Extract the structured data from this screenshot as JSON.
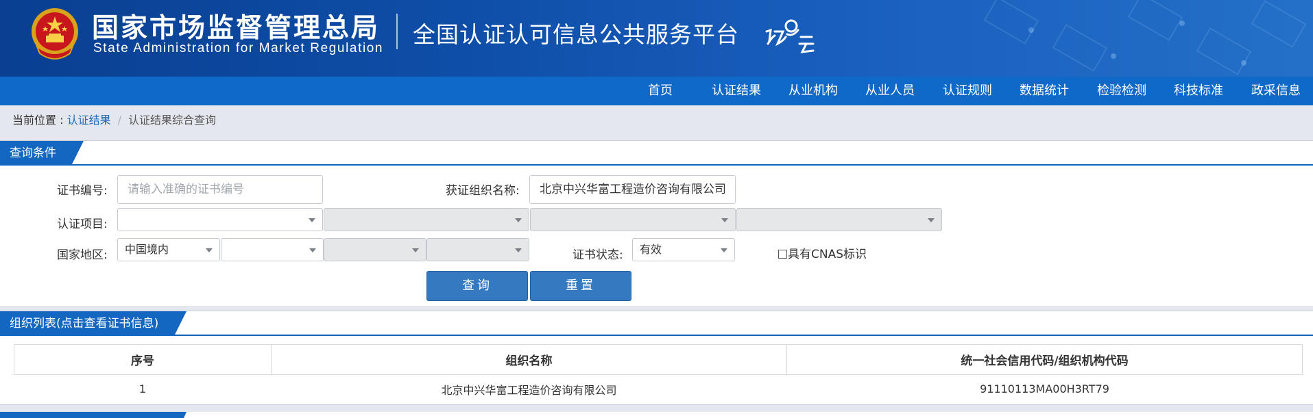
{
  "header": {
    "org_name_cn": "国家市场监督管理总局",
    "org_name_en": "State Administration  for  Market Regulation",
    "platform_title": "全国认证认可信息公共服务平台",
    "emblem_icon": "national-emblem-icon",
    "logo_icon": "renzheng-cloud-logo-icon"
  },
  "nav": {
    "items": [
      "首页",
      "认证结果",
      "从业机构",
      "从业人员",
      "认证规则",
      "数据统计",
      "检验检测",
      "科技标准",
      "政采信息"
    ]
  },
  "breadcrumb": {
    "prefix": "当前位置 : ",
    "link": "认证结果",
    "separator": "/",
    "current": "认证结果综合查询"
  },
  "query": {
    "panel_title": "查询条件",
    "cert_no_label": "证书编号:",
    "cert_no_placeholder": "请输入准确的证书编号",
    "org_name_label": "获证组织名称:",
    "org_name_value": "北京中兴华富工程造价咨询有限公司",
    "project_label": "认证项目:",
    "region_label": "国家地区:",
    "region_value": "中国境内",
    "status_label": "证书状态:",
    "status_value": "有效",
    "cnas_label": "具有CNAS标识",
    "search_button": "查询",
    "reset_button": "重置"
  },
  "results": {
    "panel_title": "组织列表(点击查看证书信息)",
    "columns": [
      "序号",
      "组织名称",
      "统一社会信用代码/组织机构代码"
    ],
    "rows": [
      [
        "1",
        "北京中兴华富工程造价咨询有限公司",
        "91110113MA00H3RT79"
      ]
    ]
  },
  "colors": {
    "nav_bg": "#0f69c8",
    "panel_tab": "#1467c1",
    "button": "#357ac1",
    "link": "#1f6bb8"
  }
}
